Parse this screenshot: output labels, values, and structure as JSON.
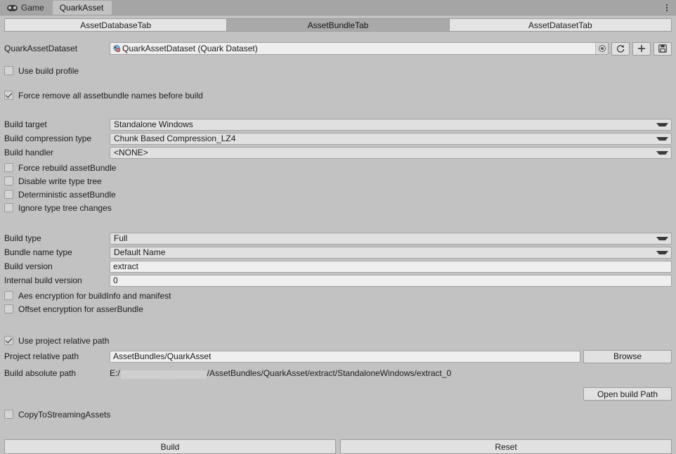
{
  "window": {
    "dock_tabs": [
      {
        "label": "Game",
        "icon": "gamepad-icon",
        "active": false
      },
      {
        "label": "QuarkAsset",
        "icon": null,
        "active": true
      }
    ],
    "menu_icon": "kebab-menu-icon"
  },
  "subtabs": [
    {
      "label": "AssetDatabaseTab",
      "active": false
    },
    {
      "label": "AssetBundleTab",
      "active": true
    },
    {
      "label": "AssetDatasetTab",
      "active": false
    }
  ],
  "dataset": {
    "label": "QuarkAssetDataset",
    "value": "QuarkAssetDataset (Quark Dataset)",
    "icon": "scriptable-object-icon",
    "picker_icon": "object-picker-icon",
    "buttons": [
      {
        "icon": "refresh-icon"
      },
      {
        "icon": "plus-icon"
      },
      {
        "icon": "save-icon"
      }
    ]
  },
  "options_top": [
    {
      "label": "Use build profile",
      "checked": false
    },
    {
      "label": "Force remove all assetbundle names before build",
      "checked": true
    }
  ],
  "build_settings": [
    {
      "label": "Build target",
      "value": "Standalone Windows"
    },
    {
      "label": "Build compression type",
      "value": "Chunk Based Compression_LZ4"
    },
    {
      "label": "Build handler",
      "value": "<NONE>"
    }
  ],
  "options_mid": [
    {
      "label": "Force rebuild assetBundle",
      "checked": false
    },
    {
      "label": "Disable write type tree",
      "checked": false
    },
    {
      "label": "Deterministic assetBundle",
      "checked": false
    },
    {
      "label": "Ignore type tree changes",
      "checked": false
    }
  ],
  "build_type_fields": [
    {
      "label": "Build type",
      "value": "Full",
      "kind": "dropdown"
    },
    {
      "label": "Bundle name type",
      "value": "Default Name",
      "kind": "dropdown"
    },
    {
      "label": "Build version",
      "value": "extract",
      "kind": "text"
    },
    {
      "label": "Internal build version",
      "value": "0",
      "kind": "text"
    }
  ],
  "options_encryption": [
    {
      "label": "Aes encryption for buildInfo and manifest",
      "checked": false
    },
    {
      "label": "Offset encryption for asserBundle",
      "checked": false
    }
  ],
  "path_section": {
    "use_project_relative_path": {
      "label": "Use project relative path",
      "checked": true
    },
    "project_relative_path": {
      "label": "Project relative path",
      "value": "AssetBundles/QuarkAsset",
      "browse_label": "Browse"
    },
    "build_absolute_path": {
      "label": "Build absolute path",
      "prefix": "E:/",
      "redacted": true,
      "suffix": "/AssetBundles/QuarkAsset/extract/StandaloneWindows/extract_0"
    },
    "open_build_path_label": "Open build Path"
  },
  "copy_to_streaming_assets": {
    "label": "CopyToStreamingAssets",
    "checked": false
  },
  "actions": [
    {
      "label": "Build"
    },
    {
      "label": "Reset"
    }
  ],
  "colors": {
    "window_bg": "#c2c2c2",
    "tabbar_bg": "#a5a5a5",
    "field_bg": "#efefef",
    "dropdown_bg": "#e0e0e0",
    "button_bg": "#e1e1e1",
    "active_subtab_bg": "#a9a9a9",
    "border": "#9b9b9b",
    "text": "#1b1b1b"
  }
}
